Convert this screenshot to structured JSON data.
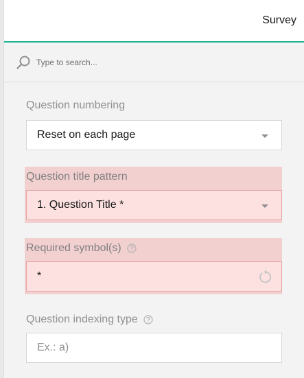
{
  "header": {
    "tab_label": "Survey"
  },
  "search": {
    "placeholder": "Type to search..."
  },
  "properties": {
    "question_numbering": {
      "label": "Question numbering",
      "value": "Reset on each page"
    },
    "question_title_pattern": {
      "label": "Question title pattern",
      "value": "1. Question Title *"
    },
    "required_symbols": {
      "label": "Required symbol(s)",
      "value": "*"
    },
    "question_indexing_type": {
      "label": "Question indexing type",
      "placeholder": "Ex.: a)"
    }
  },
  "colors": {
    "accent": "#19b394",
    "error_background": "#f3d0d0",
    "error_field": "#fde1e1"
  },
  "icons": {
    "search": "search-icon",
    "help": "help-icon",
    "dropdown": "chevron-down-icon",
    "reset": "reset-icon"
  }
}
